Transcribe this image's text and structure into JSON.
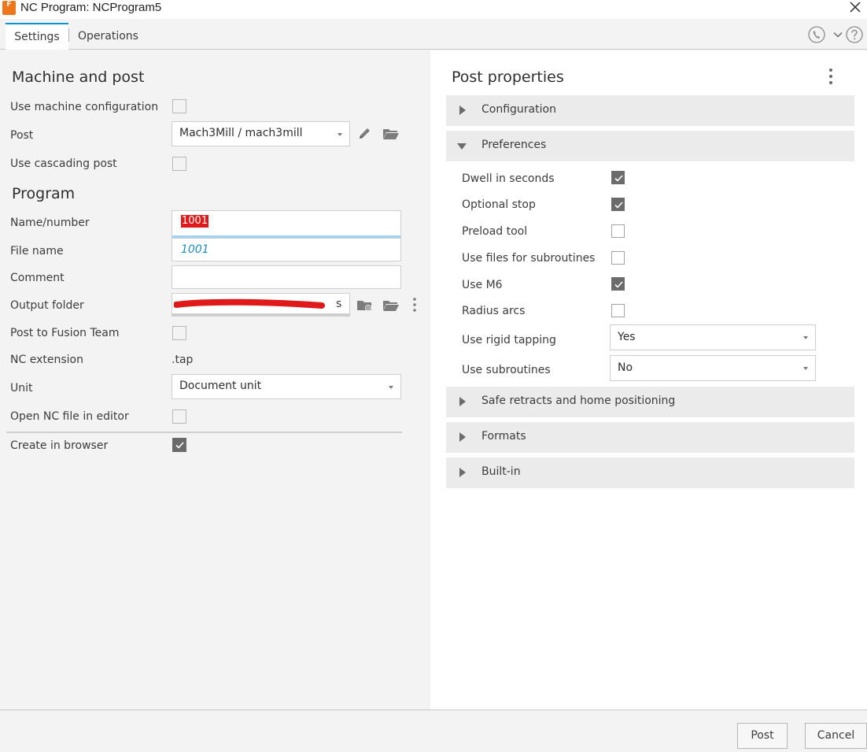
{
  "window": {
    "title": "NC Program: NCProgram5",
    "app_icon_letter": "F"
  },
  "tabs": [
    {
      "label": "Settings",
      "active": true
    },
    {
      "label": "Operations",
      "active": false
    }
  ],
  "icons": {
    "phone": "phone-icon",
    "chevron": "chevron-down-icon",
    "help": "help-icon",
    "close": "close-icon"
  },
  "machine": {
    "title": "Machine and post",
    "use_machine_config_label": "Use machine configuration",
    "use_machine_config": false,
    "post_label": "Post",
    "post_value": "Mach3Mill / mach3mill",
    "use_cascading_label": "Use cascading post",
    "use_cascading": false
  },
  "program": {
    "title": "Program",
    "name_label": "Name/number",
    "name_value": "1001",
    "file_label": "File name",
    "file_value": "1001",
    "comment_label": "Comment",
    "comment_value": "",
    "output_label": "Output folder",
    "post_fusion_label": "Post to Fusion Team",
    "post_fusion": false,
    "nc_ext_label": "NC extension",
    "nc_ext_value": ".tap",
    "unit_label": "Unit",
    "unit_value": "Document unit",
    "open_nc_label": "Open NC file in editor",
    "open_nc": false,
    "create_browser_label": "Create in browser",
    "create_browser": true
  },
  "post_properties": {
    "title": "Post properties",
    "sections": [
      {
        "label": "Configuration",
        "expanded": false
      },
      {
        "label": "Preferences",
        "expanded": true
      },
      {
        "label": "Safe retracts and home positioning",
        "expanded": false
      },
      {
        "label": "Formats",
        "expanded": false
      },
      {
        "label": "Built-in",
        "expanded": false
      }
    ],
    "preferences": [
      {
        "label": "Dwell in seconds",
        "checked": true
      },
      {
        "label": "Optional stop",
        "checked": true
      },
      {
        "label": "Preload tool",
        "checked": false
      },
      {
        "label": "Use files for subroutines",
        "checked": false
      },
      {
        "label": "Use M6",
        "checked": true
      },
      {
        "label": "Radius arcs",
        "checked": false
      }
    ],
    "rigid_tapping_label": "Use rigid tapping",
    "rigid_tapping_value": "Yes",
    "subroutines_label": "Use subroutines",
    "subroutines_value": "No"
  },
  "footer": {
    "post_label": "Post",
    "cancel_label": "Cancel"
  },
  "colors": {
    "accent": "#0696d7",
    "brand": "#f0761b",
    "redaction": "#e01a1a"
  }
}
